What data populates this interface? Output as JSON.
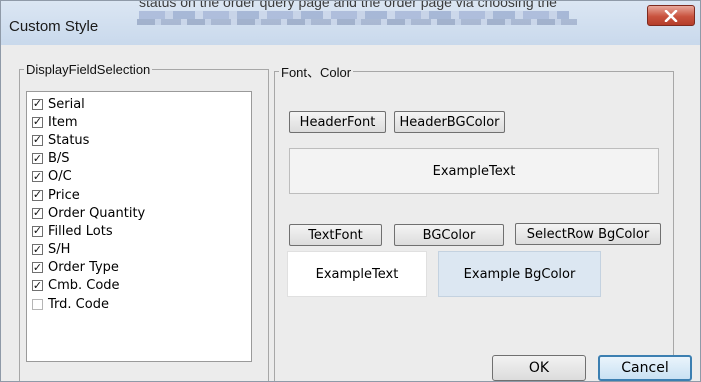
{
  "window": {
    "title": "Custom Style",
    "background_text": "status on the order query page and the order page via choosing the",
    "close_label": "x"
  },
  "display_fields": {
    "legend": "DisplayFieldSelection",
    "items": [
      {
        "label": "Serial",
        "checked": true
      },
      {
        "label": "Item",
        "checked": true
      },
      {
        "label": "Status",
        "checked": true
      },
      {
        "label": "B/S",
        "checked": true
      },
      {
        "label": "O/C",
        "checked": true
      },
      {
        "label": "Price",
        "checked": true
      },
      {
        "label": "Order Quantity",
        "checked": true
      },
      {
        "label": "Filled Lots",
        "checked": true
      },
      {
        "label": "S/H",
        "checked": true
      },
      {
        "label": "Order Type",
        "checked": true
      },
      {
        "label": "Cmb. Code",
        "checked": true
      },
      {
        "label": "Trd. Code",
        "checked": false
      }
    ]
  },
  "font_color": {
    "legend": "Font、Color",
    "header_font_label": "HeaderFont",
    "header_bgcolor_label": "HeaderBGColor",
    "header_example_text": "ExampleText",
    "text_font_label": "TextFont",
    "bgcolor_label": "BGColor",
    "select_row_bgcolor_label": "SelectRow BgColor",
    "text_example_text": "ExampleText",
    "bg_example_text": "Example BgColor",
    "colors": {
      "header_bg": "#f3f3f3",
      "text_bg": "#ffffff",
      "example_bg": "#dce7f2"
    }
  },
  "buttons": {
    "ok_label": "OK",
    "cancel_label": "Cancel"
  }
}
